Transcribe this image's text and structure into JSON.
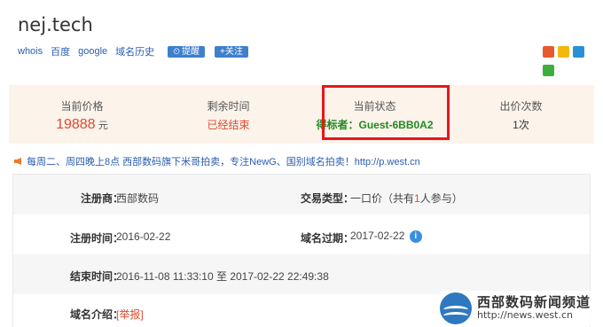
{
  "domain_title": "nej.tech",
  "links": {
    "whois": "whois",
    "baidu": "百度",
    "google": "google",
    "history": "域名历史",
    "remind_label": "提醒",
    "follow_label": "+关注"
  },
  "stats": [
    {
      "label": "当前价格",
      "value": "19888",
      "unit": "元"
    },
    {
      "label": "剩余时间",
      "value": "已经结束"
    },
    {
      "label": "当前状态",
      "value": "得标者：Guest-6BB0A2"
    },
    {
      "label": "出价次数",
      "value": "1次"
    }
  ],
  "notice": "每周二、周四晚上8点 西部数码旗下米哥拍卖，专注NewG、国别域名拍卖！http://p.west.cn",
  "details": {
    "registrar_label": "注册商：",
    "registrar_value": "西部数码",
    "trade_type_label": "交易类型：",
    "trade_type_value_a": "一口价（共有",
    "trade_type_count": "1",
    "trade_type_value_b": "人参与）",
    "reg_time_label": "注册时间：",
    "reg_time_value": "2016-02-22",
    "expire_label": "域名过期：",
    "expire_value": "2017-02-22",
    "end_time_label": "结束时间：",
    "end_time_value": "2016-11-08 11:33:10 至 2017-02-22 22:49:38",
    "intro_label": "域名介绍：",
    "intro_value": "[举报]"
  },
  "watermark": {
    "title": "西部数码新闻频道",
    "url": "http://news.west.cn"
  },
  "colors": {
    "accent_red": "#e0492f",
    "link_blue": "#2a5db0",
    "winner_green": "#1f8a1f",
    "highlight_border": "#e8161a"
  }
}
